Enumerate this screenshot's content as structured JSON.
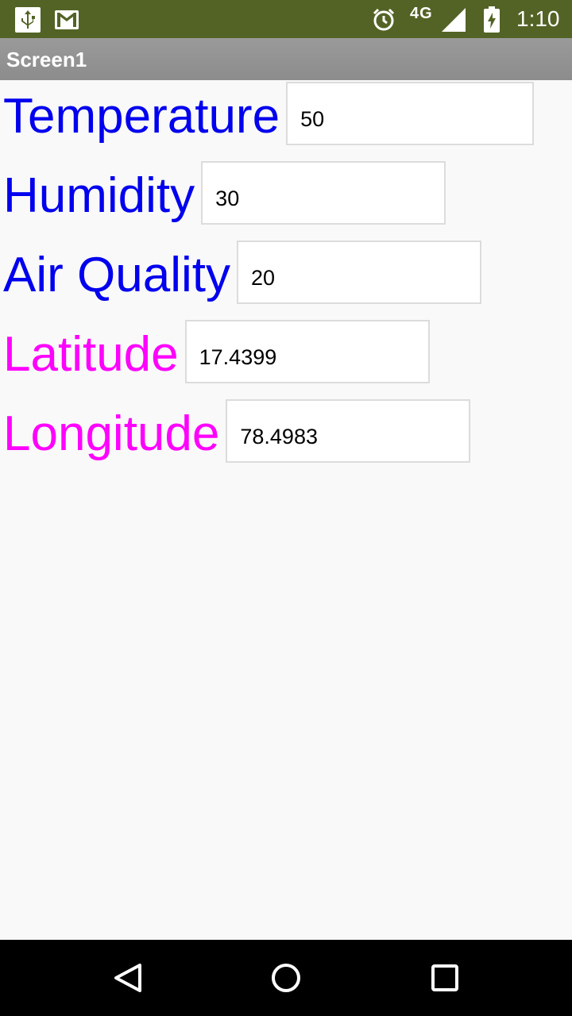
{
  "status_bar": {
    "left_icons": [
      "usb-icon",
      "gmail-icon"
    ],
    "right_icons": [
      "alarm-icon",
      "signal-icon",
      "battery-charging-icon"
    ],
    "network": "4G",
    "time": "1:10"
  },
  "title_bar": {
    "title": "Screen1"
  },
  "fields": [
    {
      "label": "Temperature",
      "value": "50",
      "color": "#0000ee"
    },
    {
      "label": "Humidity",
      "value": "30",
      "color": "#0000ee"
    },
    {
      "label": "Air Quality",
      "value": "20",
      "color": "#0000ee"
    },
    {
      "label": "Latitude",
      "value": "17.4399",
      "color": "#ff00ff"
    },
    {
      "label": "Longitude",
      "value": "78.4983",
      "color": "#ff00ff"
    }
  ],
  "nav_bar": {
    "buttons": [
      "back-icon",
      "home-icon",
      "recents-icon"
    ]
  },
  "colors": {
    "status_bar": "#536325",
    "title_bar": "#8c8c8c",
    "sensor_label": "#0000ee",
    "location_label": "#ff00ff"
  }
}
